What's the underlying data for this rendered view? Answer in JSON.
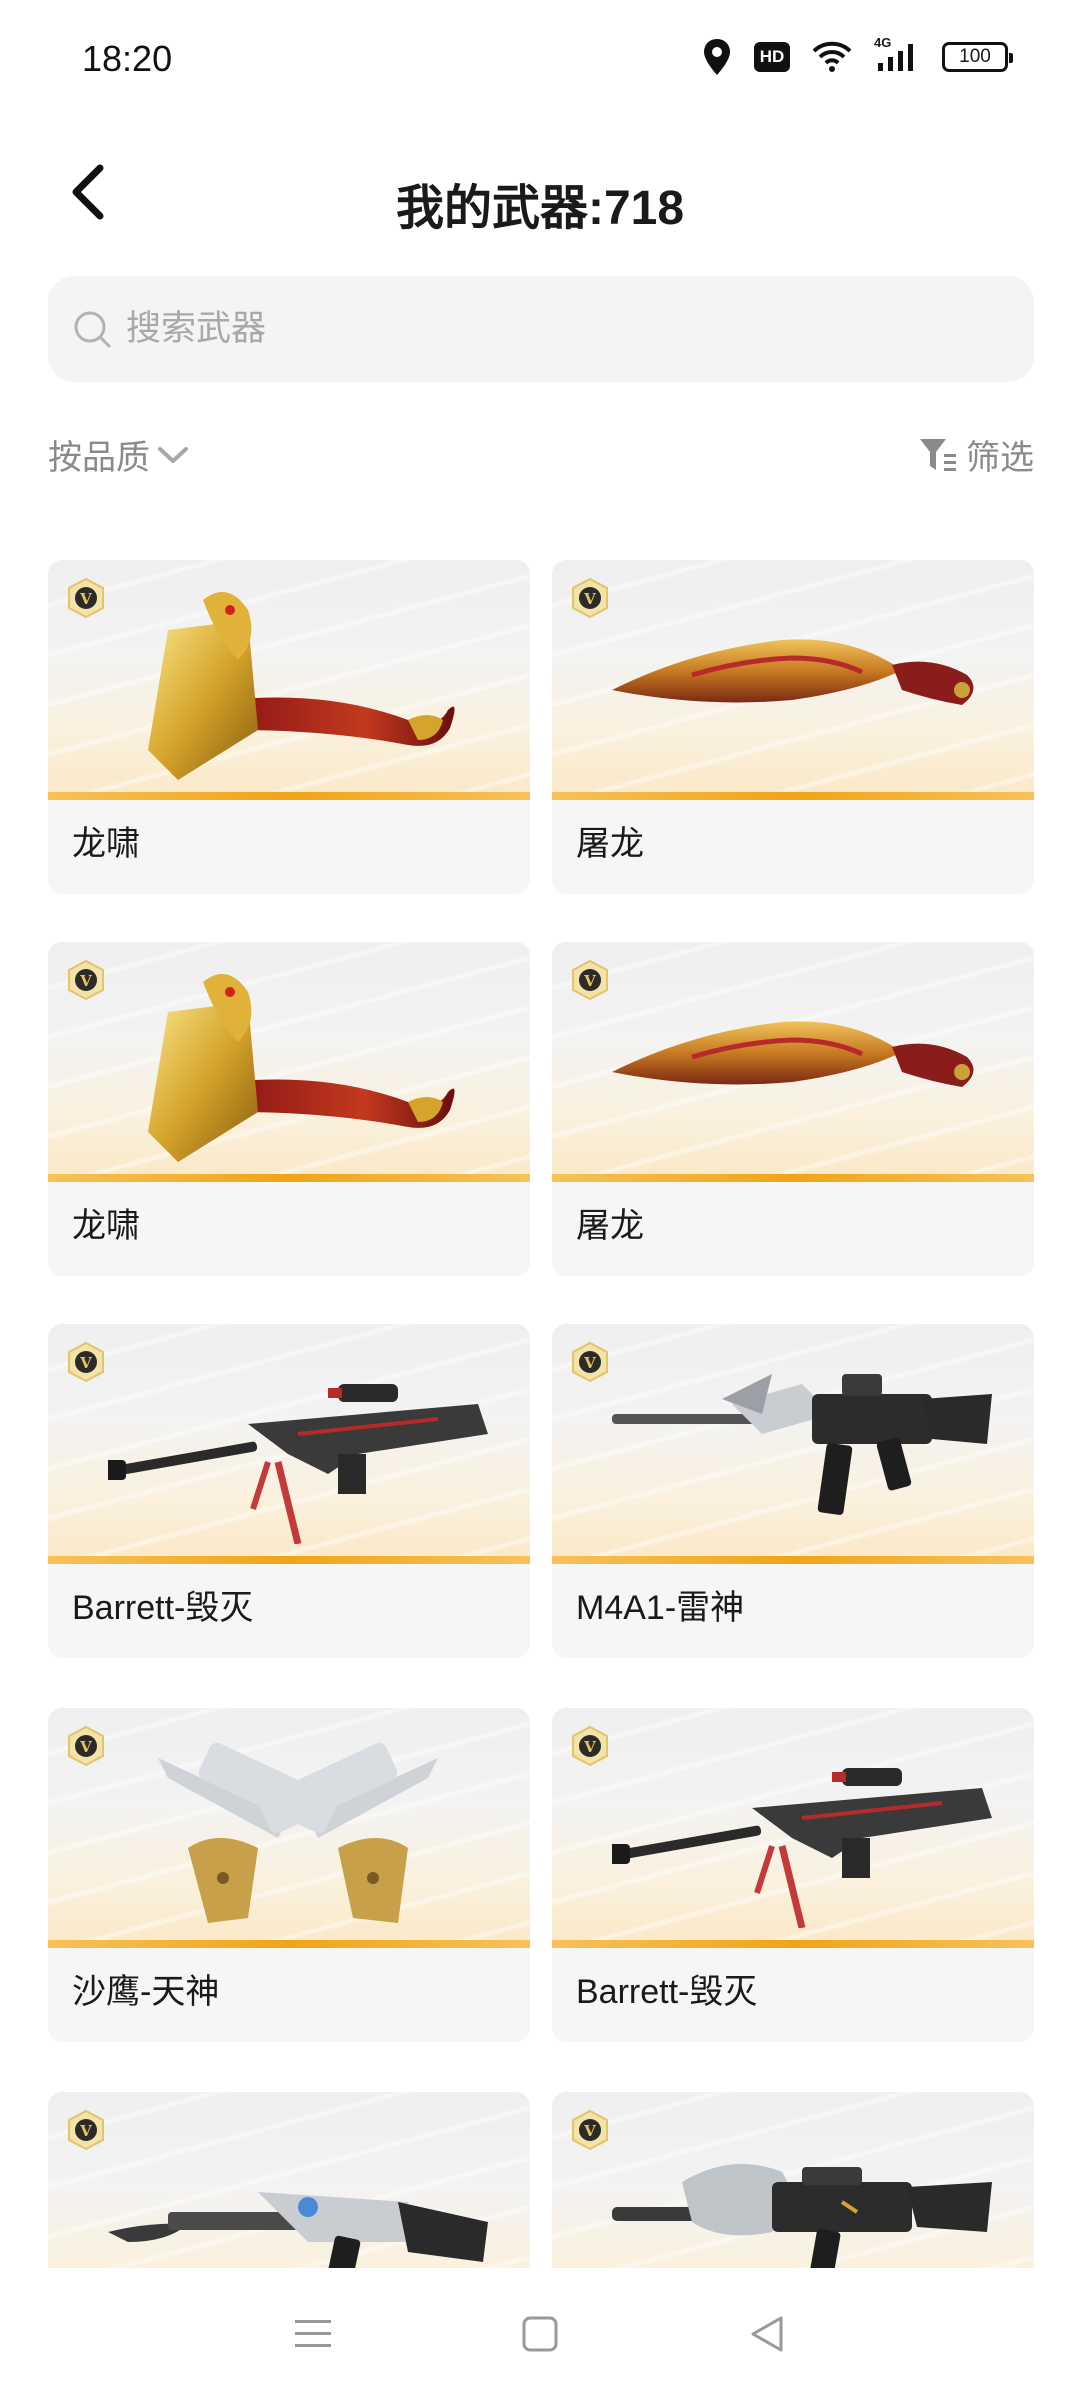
{
  "status_bar": {
    "time": "18:20",
    "hd_label": "HD",
    "network_label": "4G",
    "battery": "100",
    "icons": [
      "location-icon",
      "hd-icon",
      "wifi-icon",
      "cellular-signal-icon",
      "battery-icon"
    ]
  },
  "header": {
    "title": "我的武器:718",
    "back_icon": "chevron-left-icon"
  },
  "search": {
    "placeholder": "搜索武器",
    "value": "",
    "icon": "search-icon"
  },
  "sort": {
    "label": "按品质",
    "icon": "chevron-down-icon"
  },
  "filter": {
    "label": "筛选",
    "icon": "filter-icon"
  },
  "colors": {
    "rarity_bar": "#f0a418",
    "vip_badge": "#c9a23a",
    "text_secondary": "#8a8a8a",
    "search_bg": "#f4f4f4"
  },
  "weapons": [
    {
      "name": "龙啸",
      "art": "dragon-axe"
    },
    {
      "name": "屠龙",
      "art": "dragon-kukri"
    },
    {
      "name": "龙啸",
      "art": "dragon-axe"
    },
    {
      "name": "屠龙",
      "art": "dragon-kukri"
    },
    {
      "name": "Barrett-毁灭",
      "art": "sniper-rifle"
    },
    {
      "name": "M4A1-雷神",
      "art": "assault-rifle"
    },
    {
      "name": "沙鹰-天神",
      "art": "dual-pistols"
    },
    {
      "name": "Barrett-毁灭",
      "art": "sniper-rifle"
    },
    {
      "name": "",
      "art": "ak-rifle"
    },
    {
      "name": "",
      "art": "m4-dragon"
    }
  ],
  "nav_bar": {
    "icons": [
      "menu-icon",
      "home-square-icon",
      "back-triangle-icon"
    ]
  }
}
